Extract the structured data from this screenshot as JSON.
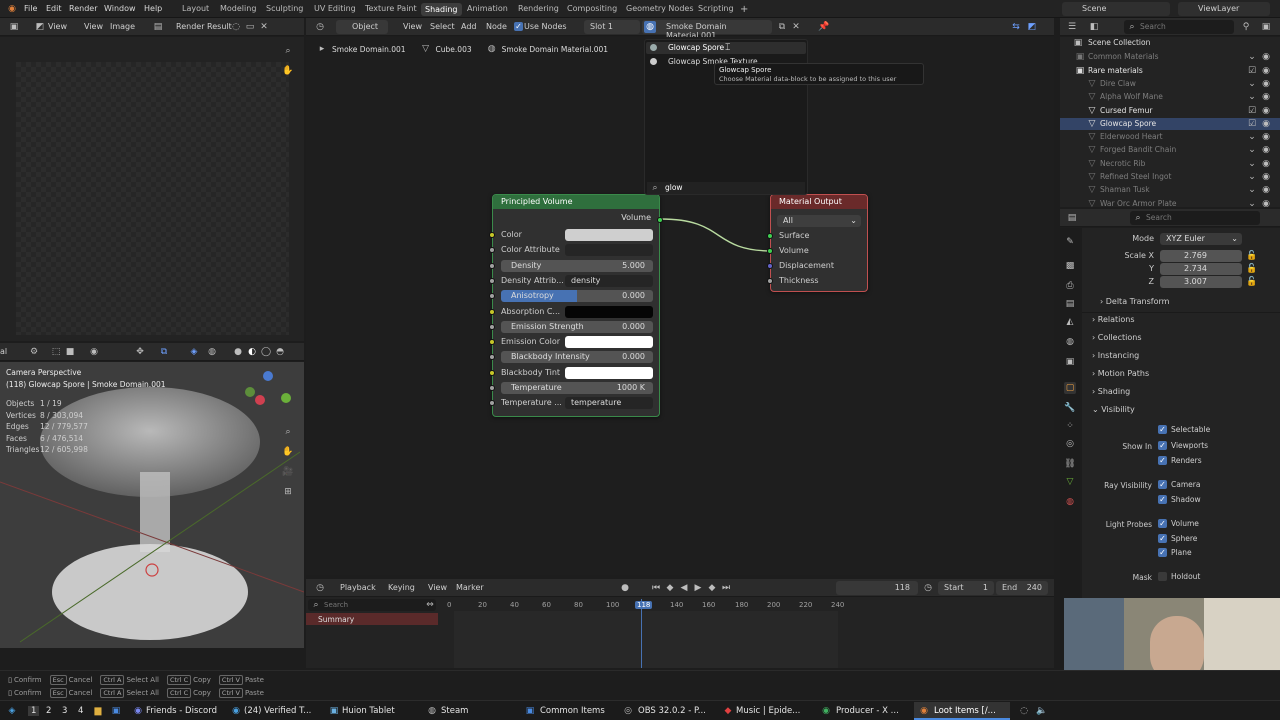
{
  "topbar": {
    "menus": [
      "File",
      "Edit",
      "Render",
      "Window",
      "Help"
    ],
    "workspaces": [
      "Layout",
      "Modeling",
      "Sculpting",
      "UV Editing",
      "Texture Paint",
      "Shading",
      "Animation",
      "Rendering",
      "Compositing",
      "Geometry Nodes",
      "Scripting"
    ],
    "active_workspace": "Shading",
    "scene": "Scene",
    "view_layer": "ViewLayer"
  },
  "image_editor": {
    "view": "View",
    "view2": "View",
    "image": "Image",
    "render_result": "Render Result"
  },
  "node_header": {
    "mode": "Object",
    "menus": [
      "View",
      "Select",
      "Add",
      "Node"
    ],
    "use_nodes": "Use Nodes",
    "slot": "Slot 1",
    "material": "Smoke Domain Material.001"
  },
  "breadcrumb": {
    "object": "Smoke Domain.001",
    "mesh": "Cube.003",
    "material": "Smoke Domain Material.001"
  },
  "material_dropdown": {
    "items": [
      "Glowcap Spore",
      "Glowcap Smoke Texture"
    ],
    "tooltip_title": "Glowcap Spore",
    "tooltip_desc": "Choose Material data-block to be assigned to this user",
    "search": "glow"
  },
  "principled_volume": {
    "title": "Principled Volume",
    "output": "Volume",
    "rows": [
      {
        "label": "Color",
        "value": ""
      },
      {
        "label": "Color Attribute",
        "value": ""
      },
      {
        "label": "Density",
        "value": "5.000"
      },
      {
        "label": "Density Attrib...",
        "value": "density"
      },
      {
        "label": "Anisotropy",
        "value": "0.000"
      },
      {
        "label": "Absorption C...",
        "value": ""
      },
      {
        "label": "Emission Strength",
        "value": "0.000"
      },
      {
        "label": "Emission Color",
        "value": ""
      },
      {
        "label": "Blackbody Intensity",
        "value": "0.000"
      },
      {
        "label": "Blackbody Tint",
        "value": ""
      },
      {
        "label": "Temperature",
        "value": "1000 K"
      },
      {
        "label": "Temperature ...",
        "value": "temperature"
      }
    ]
  },
  "material_output": {
    "title": "Material Output",
    "target": "All",
    "inputs": [
      "Surface",
      "Volume",
      "Displacement",
      "Thickness"
    ]
  },
  "viewport": {
    "camera": "Camera Perspective",
    "object_line": "(118) Glowcap Spore | Smoke Domain.001",
    "stats": [
      {
        "label": "Objects",
        "value": "1 / 19"
      },
      {
        "label": "Vertices",
        "value": "8 / 303,094"
      },
      {
        "label": "Edges",
        "value": "12 / 779,577"
      },
      {
        "label": "Faces",
        "value": "6 / 476,514"
      },
      {
        "label": "Triangles",
        "value": "12 / 605,998"
      }
    ],
    "shading_label": "al"
  },
  "outliner": {
    "search_placeholder": "Search",
    "collection": "Scene Collection",
    "items": [
      {
        "label": "Common Materials",
        "dim": true
      },
      {
        "label": "Rare materials",
        "dim": false
      },
      {
        "label": "Dire Claw",
        "dim": true
      },
      {
        "label": "Alpha Wolf Mane",
        "dim": true
      },
      {
        "label": "Cursed Femur",
        "dim": false
      },
      {
        "label": "Glowcap Spore",
        "dim": false
      },
      {
        "label": "Elderwood Heart",
        "dim": true
      },
      {
        "label": "Forged Bandit Chain",
        "dim": true
      },
      {
        "label": "Necrotic Rib",
        "dim": true
      },
      {
        "label": "Refined Steel Ingot",
        "dim": true
      },
      {
        "label": "Shaman Tusk",
        "dim": true
      },
      {
        "label": "War Orc Armor Plate",
        "dim": true
      }
    ]
  },
  "properties": {
    "search_placeholder": "Search",
    "mode_label": "Mode",
    "mode_value": "XYZ Euler",
    "scale": [
      {
        "label": "Scale X",
        "value": "2.769"
      },
      {
        "label": "Y",
        "value": "2.734"
      },
      {
        "label": "Z",
        "value": "3.007"
      }
    ],
    "sections": [
      "Delta Transform",
      "Relations",
      "Collections",
      "Instancing",
      "Motion Paths",
      "Shading",
      "Visibility"
    ],
    "selectable": "Selectable",
    "show_in": "Show In",
    "viewports": "Viewports",
    "renders": "Renders",
    "ray_visibility": "Ray Visibility",
    "camera": "Camera",
    "shadow": "Shadow",
    "light_probes": "Light Probes",
    "volume": "Volume",
    "sphere": "Sphere",
    "plane": "Plane",
    "mask": "Mask",
    "holdout": "Holdout"
  },
  "timeline": {
    "menus": [
      "Playback",
      "Keying",
      "View",
      "Marker"
    ],
    "current_frame": "118",
    "start_label": "Start",
    "start": "1",
    "end_label": "End",
    "end": "240",
    "search_placeholder": "Search",
    "summary": "Summary",
    "ticks": [
      "0",
      "20",
      "40",
      "60",
      "80",
      "100",
      "118",
      "140",
      "160",
      "180",
      "200",
      "220",
      "240"
    ]
  },
  "statusbar": {
    "line1": [
      {
        "key": "",
        "label": "Confirm"
      },
      {
        "key": "Esc",
        "label": "Cancel"
      },
      {
        "key": "Ctrl A",
        "label": "Select All"
      },
      {
        "key": "Ctrl C",
        "label": "Copy"
      },
      {
        "key": "Ctrl V",
        "label": "Paste"
      }
    ],
    "line2": [
      {
        "key": "",
        "label": "Confirm"
      },
      {
        "key": "Esc",
        "label": "Cancel"
      },
      {
        "key": "Ctrl A",
        "label": "Select All"
      },
      {
        "key": "Ctrl C",
        "label": "Copy"
      },
      {
        "key": "Ctrl V",
        "label": "Paste"
      }
    ]
  },
  "taskbar": {
    "desktops": [
      "1",
      "2",
      "3",
      "4"
    ],
    "items": [
      "Friends - Discord",
      "(24) Verified T...",
      "Huion Tablet",
      "Steam",
      "Common Items",
      "OBS 32.0.2 - P...",
      "Music | Epide...",
      "Producer - X ...",
      "Loot Items [/..."
    ]
  },
  "colors": {
    "accent": "#4772b3",
    "volume_header": "#2f6f3d",
    "output_header": "#6a2a2a",
    "socket_yellow": "#c7c729",
    "socket_green": "#3fcf52",
    "socket_grey": "#a1a1a1",
    "socket_blue": "#6363c7"
  }
}
